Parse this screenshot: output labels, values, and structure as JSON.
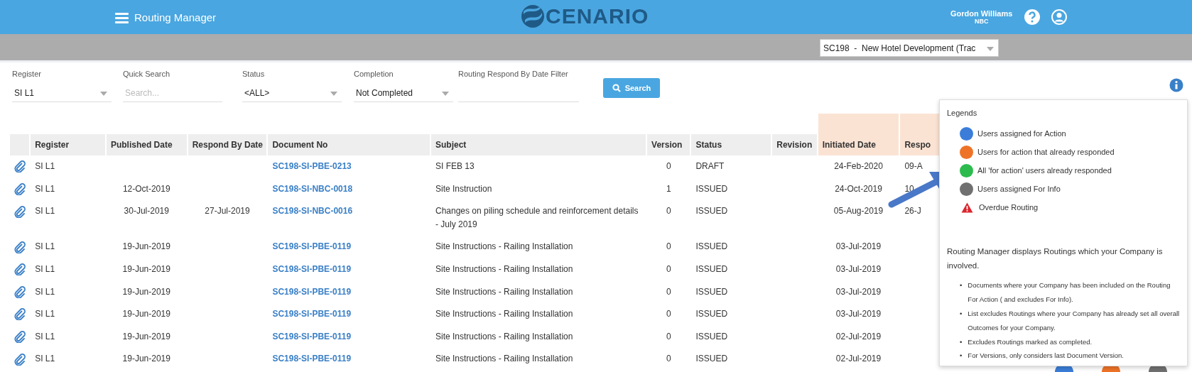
{
  "header": {
    "title": "Routing Manager",
    "logo_text": "CENARIO",
    "user_name": "Gordon Williams",
    "user_company": "NBC"
  },
  "project_select": {
    "value": "SC198  -  New Hotel Development (Trac"
  },
  "filters": [
    {
      "label": "Register",
      "kind": "select",
      "value": "SI L1"
    },
    {
      "label": "Quick Search",
      "kind": "text",
      "placeholder": "Search..."
    },
    {
      "label": "Status",
      "kind": "select",
      "value": "<ALL>"
    },
    {
      "label": "Completion",
      "kind": "select",
      "value": "Not Completed"
    },
    {
      "label": "Routing Respond By Date Filter",
      "kind": "text"
    }
  ],
  "search_button": "Search",
  "table": {
    "columns": [
      "Register",
      "Published Date",
      "Respond By Date",
      "Document No",
      "Subject",
      "Version",
      "Status",
      "Revision",
      "Initiated Date",
      "Respo"
    ],
    "rows": [
      {
        "register": "SI L1",
        "published": "",
        "respond_by": "",
        "doc_no": "SC198-SI-PBE-0213",
        "subject": "SI FEB 13",
        "version": "0",
        "status": "DRAFT",
        "revision": "",
        "initiated": "24-Feb-2020",
        "column_10": "09-A"
      },
      {
        "register": "SI L1",
        "published": "12-Oct-2019",
        "respond_by": "",
        "doc_no": "SC198-SI-NBC-0018",
        "subject": "Site Instruction",
        "version": "1",
        "status": "ISSUED",
        "revision": "",
        "initiated": "24-Oct-2019",
        "column_10": "10"
      },
      {
        "register": "SI L1",
        "published": "30-Jul-2019",
        "respond_by": "27-Jul-2019",
        "doc_no": "SC198-SI-NBC-0016",
        "subject": "Changes on piling schedule and reinforcement details - July 2019",
        "version": "0",
        "status": "ISSUED",
        "revision": "",
        "initiated": "05-Aug-2019",
        "column_10": "26-J"
      },
      {
        "register": "SI L1",
        "published": "19-Jun-2019",
        "respond_by": "",
        "doc_no": "SC198-SI-PBE-0119",
        "subject": "Site Instructions - Railing Installation",
        "version": "0",
        "status": "ISSUED",
        "revision": "",
        "initiated": "03-Jul-2019",
        "column_10": ""
      },
      {
        "register": "SI L1",
        "published": "19-Jun-2019",
        "respond_by": "",
        "doc_no": "SC198-SI-PBE-0119",
        "subject": "Site Instructions - Railing Installation",
        "version": "0",
        "status": "ISSUED",
        "revision": "",
        "initiated": "03-Jul-2019",
        "column_10": ""
      },
      {
        "register": "SI L1",
        "published": "19-Jun-2019",
        "respond_by": "",
        "doc_no": "SC198-SI-PBE-0119",
        "subject": "Site Instructions - Railing Installation",
        "version": "0",
        "status": "ISSUED",
        "revision": "",
        "initiated": "03-Jul-2019",
        "column_10": ""
      },
      {
        "register": "SI L1",
        "published": "19-Jun-2019",
        "respond_by": "",
        "doc_no": "SC198-SI-PBE-0119",
        "subject": "Site Instructions - Railing Installation",
        "version": "0",
        "status": "ISSUED",
        "revision": "",
        "initiated": "03-Jul-2019",
        "column_10": ""
      },
      {
        "register": "SI L1",
        "published": "19-Jun-2019",
        "respond_by": "",
        "doc_no": "SC198-SI-PBE-0119",
        "subject": "Site Instructions - Railing Installation",
        "version": "0",
        "status": "ISSUED",
        "revision": "",
        "initiated": "02-Jul-2019",
        "column_10": ""
      },
      {
        "register": "SI L1",
        "published": "19-Jun-2019",
        "respond_by": "",
        "doc_no": "SC198-SI-PBE-0119",
        "subject": "Site Instructions - Railing Installation",
        "version": "0",
        "status": "ISSUED",
        "revision": "",
        "initiated": "02-Jul-2019",
        "column_10": ""
      }
    ],
    "partial_dots": [
      {
        "color": "#3b7dd8"
      },
      {
        "color": "#ee7328"
      },
      {
        "color": "#707070"
      }
    ]
  },
  "legend": {
    "title": "Legends",
    "items": [
      {
        "kind": "dot",
        "color": "#3b7dd8",
        "label": "Users assigned for Action"
      },
      {
        "kind": "dot",
        "color": "#ee7328",
        "label": "Users for action that already responded"
      },
      {
        "kind": "dot",
        "color": "#2dbb4e",
        "label": "All 'for action' users already responded"
      },
      {
        "kind": "dot",
        "color": "#707070",
        "label": "Users assigned For Info"
      },
      {
        "kind": "warning",
        "label": "Overdue Routing"
      }
    ],
    "description": "Routing Manager displays Routings which your Company is involved.",
    "note_marker": "•",
    "notes": [
      "Documents where your Company has been included on the Routing For Action ( and excludes For Info).",
      "List excludes Routings where your Company has already set all overall Outcomes for your Company.",
      "Excludes Routings marked as completed.",
      "For Versions, only considers last Document Version."
    ]
  }
}
